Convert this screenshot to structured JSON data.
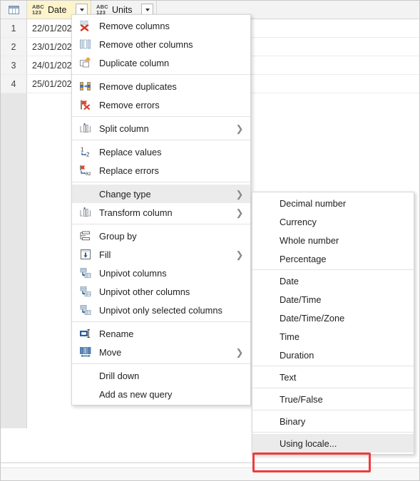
{
  "app": {
    "name": "power-query-editor"
  },
  "grid": {
    "corner_icon": "table-icon",
    "columns": [
      {
        "name": "Date",
        "type_icon": "abc123-icon",
        "type_top": "ABC",
        "type_bottom": "123",
        "selected": true,
        "dropdown_icon": "chevron-down-icon"
      },
      {
        "name": "Units",
        "type_icon": "abc123-icon",
        "type_top": "ABC",
        "type_bottom": "123",
        "selected": false,
        "dropdown_icon": "chevron-down-icon"
      }
    ],
    "rows": [
      {
        "num": "1",
        "date": "22/01/202",
        "units": ""
      },
      {
        "num": "2",
        "date": "23/01/202",
        "units": ""
      },
      {
        "num": "3",
        "date": "24/01/202",
        "units": ""
      },
      {
        "num": "4",
        "date": "25/01/202",
        "units": ""
      }
    ]
  },
  "context_menu": {
    "groups": [
      {
        "items": [
          {
            "label": "Remove columns",
            "icon": "remove-columns-icon",
            "submenu": false
          },
          {
            "label": "Remove other columns",
            "icon": "remove-other-columns-icon",
            "submenu": false
          },
          {
            "label": "Duplicate column",
            "icon": "duplicate-column-icon",
            "submenu": false
          }
        ]
      },
      {
        "items": [
          {
            "label": "Remove duplicates",
            "icon": "remove-duplicates-icon",
            "submenu": false
          },
          {
            "label": "Remove errors",
            "icon": "remove-errors-icon",
            "submenu": false
          }
        ]
      },
      {
        "items": [
          {
            "label": "Split column",
            "icon": "split-column-icon",
            "submenu": true
          }
        ]
      },
      {
        "items": [
          {
            "label": "Replace values",
            "icon": "replace-values-icon",
            "submenu": false
          },
          {
            "label": "Replace errors",
            "icon": "replace-errors-icon",
            "submenu": false
          }
        ]
      },
      {
        "items": [
          {
            "label": "Change type",
            "icon": "none",
            "submenu": true,
            "highlighted": true
          },
          {
            "label": "Transform column",
            "icon": "transform-column-icon",
            "submenu": true
          }
        ]
      },
      {
        "items": [
          {
            "label": "Group by",
            "icon": "group-by-icon",
            "submenu": false
          },
          {
            "label": "Fill",
            "icon": "fill-icon",
            "submenu": true
          },
          {
            "label": "Unpivot columns",
            "icon": "unpivot-icon",
            "submenu": false
          },
          {
            "label": "Unpivot other columns",
            "icon": "unpivot-icon",
            "submenu": false
          },
          {
            "label": "Unpivot only selected columns",
            "icon": "unpivot-icon",
            "submenu": false
          }
        ]
      },
      {
        "items": [
          {
            "label": "Rename",
            "icon": "rename-icon",
            "submenu": false
          },
          {
            "label": "Move",
            "icon": "move-icon",
            "submenu": true
          }
        ]
      },
      {
        "items": [
          {
            "label": "Drill down",
            "icon": "none",
            "submenu": false
          },
          {
            "label": "Add as new query",
            "icon": "none",
            "submenu": false
          }
        ]
      }
    ]
  },
  "submenu": {
    "title": "Change type",
    "groups": [
      {
        "items": [
          {
            "label": "Decimal number"
          },
          {
            "label": "Currency"
          },
          {
            "label": "Whole number"
          },
          {
            "label": "Percentage"
          }
        ]
      },
      {
        "items": [
          {
            "label": "Date"
          },
          {
            "label": "Date/Time"
          },
          {
            "label": "Date/Time/Zone"
          },
          {
            "label": "Time"
          },
          {
            "label": "Duration"
          }
        ]
      },
      {
        "items": [
          {
            "label": "Text"
          }
        ]
      },
      {
        "items": [
          {
            "label": "True/False"
          }
        ]
      },
      {
        "items": [
          {
            "label": "Binary"
          }
        ]
      },
      {
        "items": [
          {
            "label": "Using locale...",
            "highlighted": true,
            "annotated": true
          }
        ]
      }
    ]
  },
  "annotation": {
    "target": "Using locale...",
    "color": "#ef3b3b"
  }
}
